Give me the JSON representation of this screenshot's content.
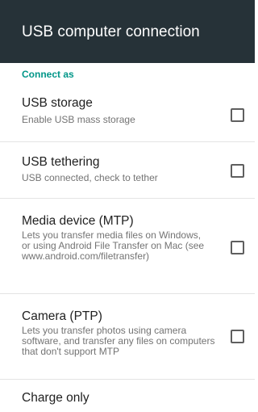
{
  "header": {
    "title": "USB computer connection"
  },
  "section": {
    "label": "Connect as"
  },
  "options": [
    {
      "title": "USB storage",
      "subtitle": "Enable USB mass storage",
      "checked": false
    },
    {
      "title": "USB tethering",
      "subtitle": "USB connected, check to tether",
      "checked": false
    },
    {
      "title": "Media device (MTP)",
      "subtitle": "Lets you transfer media files on Windows, or using Android File Transfer on Mac (see www.android.com/filetransfer)",
      "checked": false
    },
    {
      "title": "Camera (PTP)",
      "subtitle": "Lets you transfer photos using camera software, and transfer any files on computers that don't support MTP",
      "checked": false
    },
    {
      "title": "Charge only"
    }
  ],
  "colors": {
    "title_bar": "#263238",
    "accent": "#009688"
  }
}
